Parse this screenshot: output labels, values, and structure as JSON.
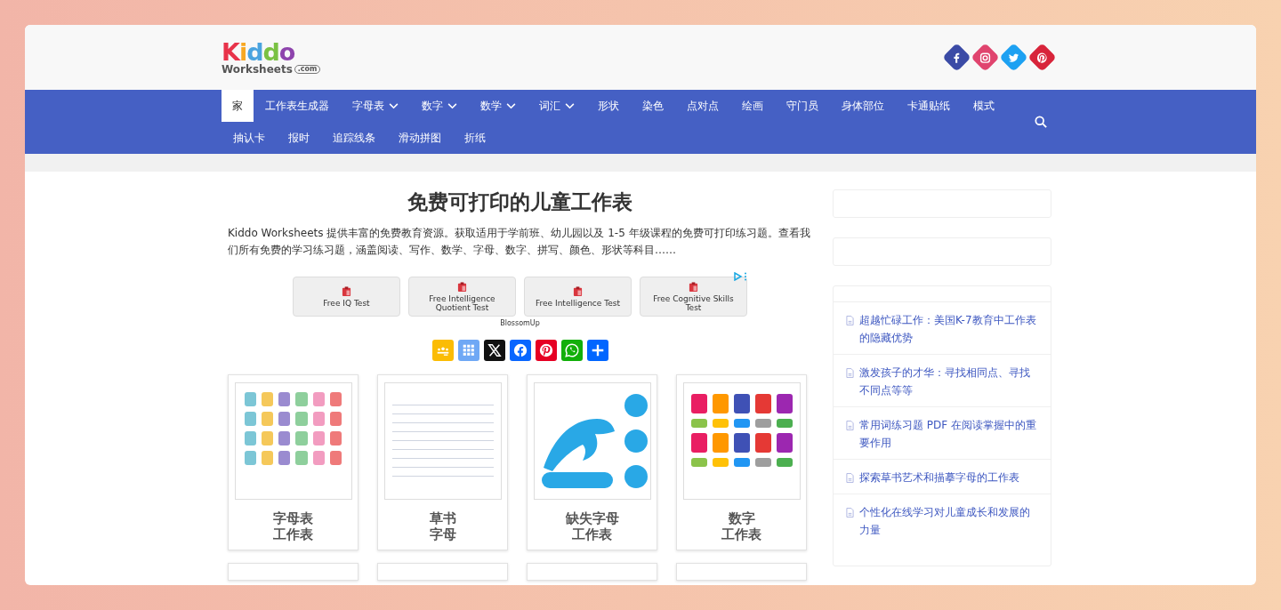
{
  "logo": {
    "name": "Kiddo",
    "sub": "Worksheets",
    "domain": ".com"
  },
  "social": [
    {
      "kind": "facebook",
      "color": "#3b4ba6"
    },
    {
      "kind": "instagram",
      "color": "#e0446e"
    },
    {
      "kind": "twitter",
      "color": "#1da1f2"
    },
    {
      "kind": "pinterest",
      "color": "#d8243a"
    }
  ],
  "nav": {
    "rows": [
      [
        {
          "label": "家",
          "selected": true,
          "dropdown": false
        },
        {
          "label": "工作表生成器",
          "selected": false,
          "dropdown": false
        },
        {
          "label": "字母表",
          "selected": false,
          "dropdown": true
        },
        {
          "label": "数字",
          "selected": false,
          "dropdown": true
        },
        {
          "label": "数学",
          "selected": false,
          "dropdown": true
        },
        {
          "label": "词汇",
          "selected": false,
          "dropdown": true
        },
        {
          "label": "形状",
          "selected": false,
          "dropdown": false
        },
        {
          "label": "染色",
          "selected": false,
          "dropdown": false
        },
        {
          "label": "点对点",
          "selected": false,
          "dropdown": false
        },
        {
          "label": "绘画",
          "selected": false,
          "dropdown": false
        },
        {
          "label": "守门员",
          "selected": false,
          "dropdown": false
        },
        {
          "label": "身体部位",
          "selected": false,
          "dropdown": false
        },
        {
          "label": "卡通贴纸",
          "selected": false,
          "dropdown": false
        },
        {
          "label": "模式",
          "selected": false,
          "dropdown": false
        }
      ],
      [
        {
          "label": "抽认卡",
          "selected": false,
          "dropdown": false
        },
        {
          "label": "报时",
          "selected": false,
          "dropdown": false
        },
        {
          "label": "追踪线条",
          "selected": false,
          "dropdown": false
        },
        {
          "label": "滑动拼图",
          "selected": false,
          "dropdown": false
        },
        {
          "label": "折纸",
          "selected": false,
          "dropdown": false
        }
      ]
    ]
  },
  "main": {
    "title": "免费可打印的儿童工作表",
    "intro": "Kiddo Worksheets 提供丰富的免费教育资源。获取适用于学前班、幼儿园以及 1-5 年级课程的免费可打印练习题。查看我们所有免费的学习练习题，涵盖阅读、写作、数学、字母、数字、拼写、颜色、形状等科目……",
    "ad": {
      "buttons": [
        "Free IQ Test",
        "Free Intelligence Quotient Test",
        "Free Intelligence Test",
        "Free Cognitive Skills Test"
      ],
      "sponsor": "BlossomUp"
    },
    "share": [
      {
        "kind": "classroom",
        "color": "#fbbc04"
      },
      {
        "kind": "grid",
        "color": "#6fa8f5"
      },
      {
        "kind": "x",
        "color": "#111111"
      },
      {
        "kind": "facebook",
        "color": "#0866ff"
      },
      {
        "kind": "pinterest",
        "color": "#e60023"
      },
      {
        "kind": "whatsapp",
        "color": "#12af0a"
      },
      {
        "kind": "share",
        "color": "#0166ff"
      }
    ],
    "cards": [
      {
        "title": [
          "字母表",
          "工作表"
        ],
        "kind": "alphabet"
      },
      {
        "title": [
          "草书",
          "字母"
        ],
        "kind": "cursive"
      },
      {
        "title": [
          "缺失字母",
          "工作表"
        ],
        "kind": "dolphin"
      },
      {
        "title": [
          "数字",
          "工作表"
        ],
        "kind": "numbers"
      }
    ]
  },
  "sidebar": {
    "posts": [
      "超越忙碌工作：美国K-7教育中工作表的隐藏优势",
      "激发孩子的才华：寻找相同点、寻找不同点等等",
      "常用词练习题 PDF 在阅读掌握中的重要作用",
      "探索草书艺术和描摹字母的工作表",
      "个性化在线学习对儿童成长和发展的力量"
    ]
  }
}
